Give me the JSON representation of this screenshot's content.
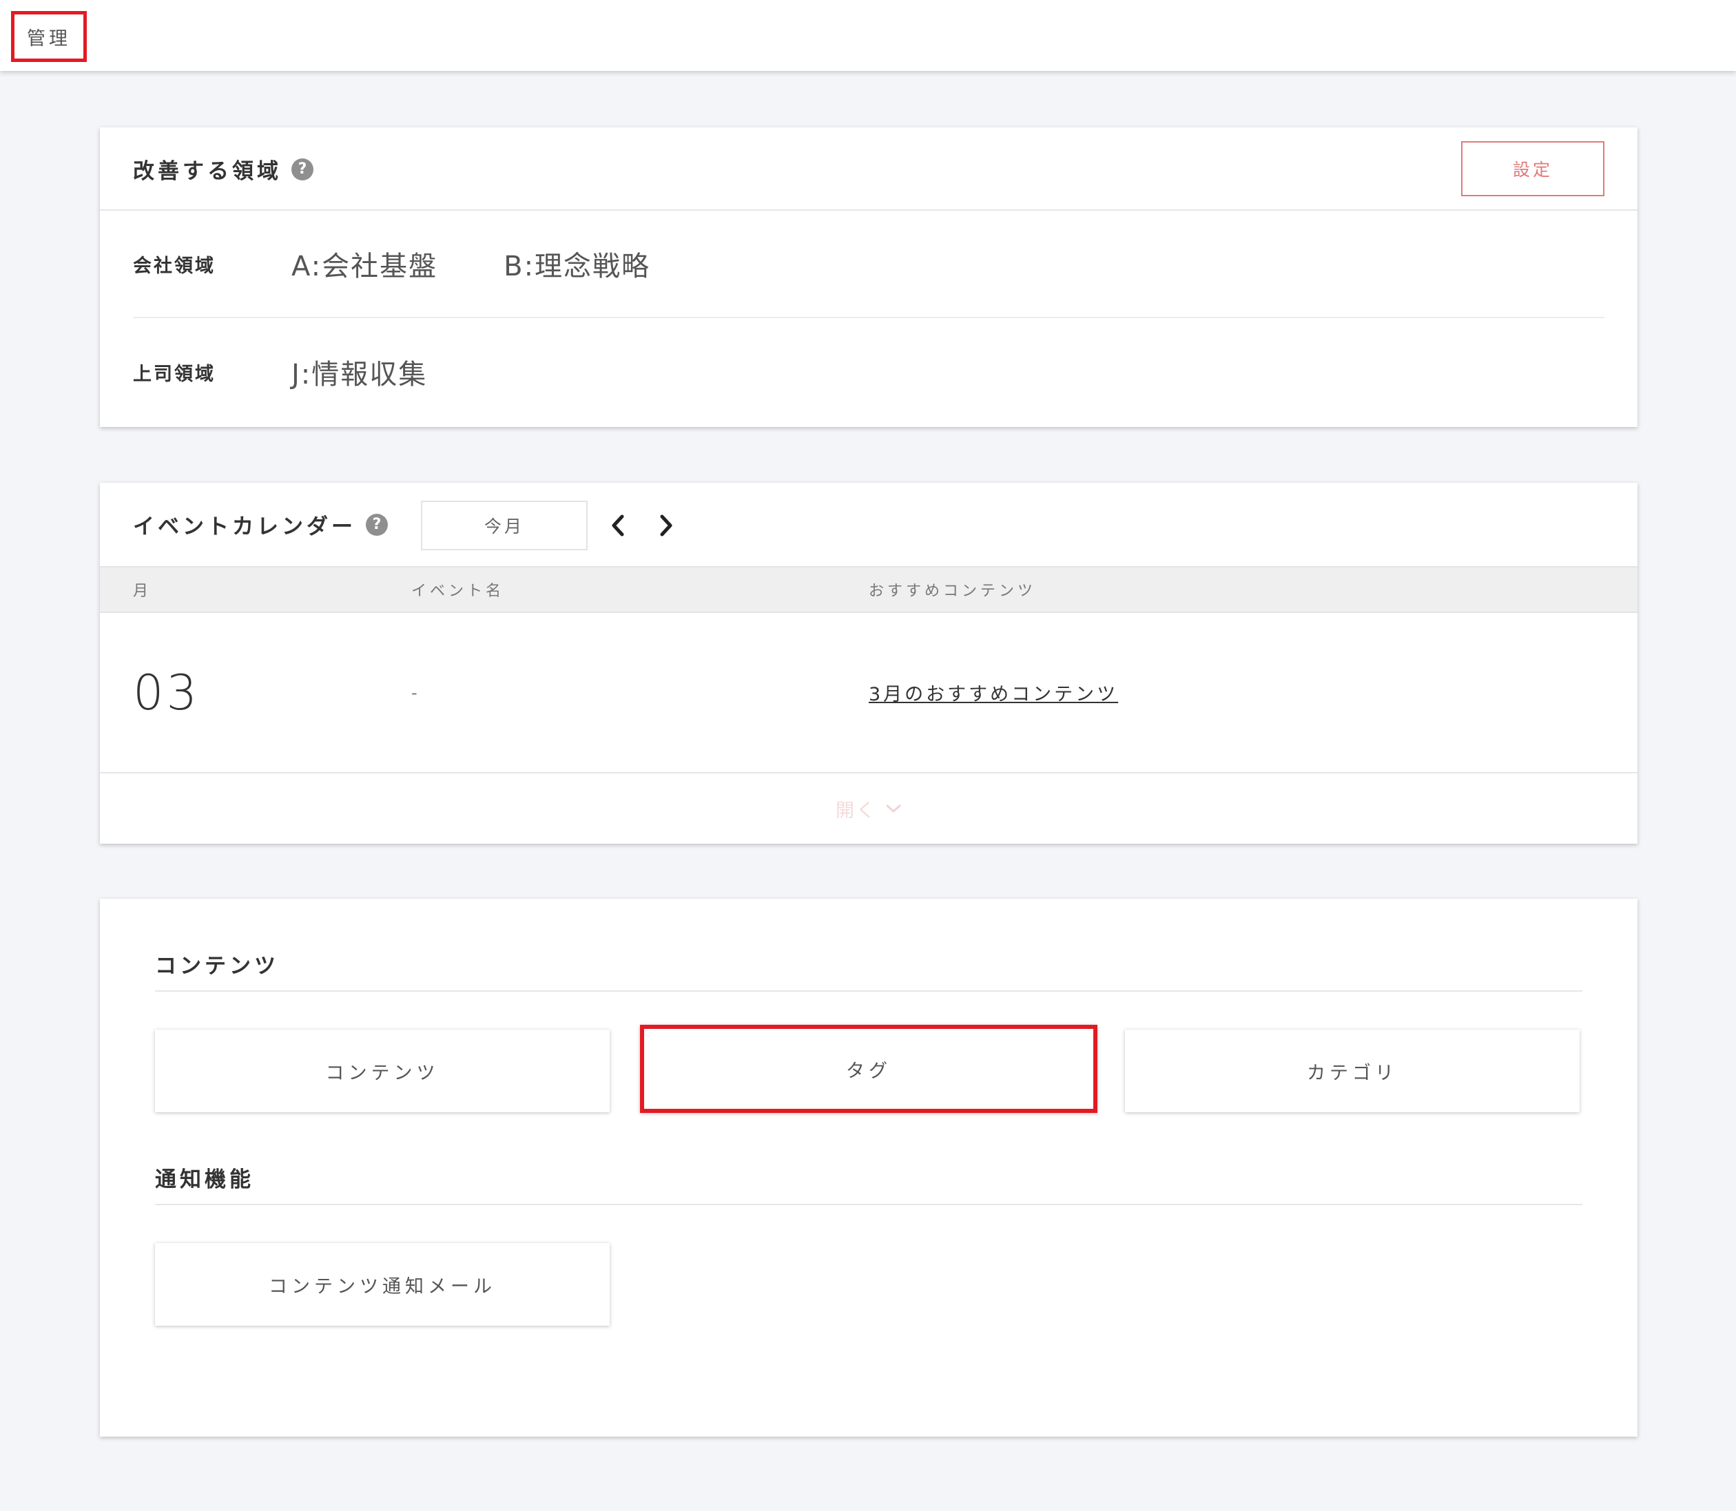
{
  "topbar": {
    "title": "管理"
  },
  "improvement": {
    "title": "改善する領域",
    "help": "?",
    "settings_label": "設定",
    "rows": [
      {
        "label": "会社領域",
        "values": [
          "A:会社基盤",
          "B:理念戦略"
        ]
      },
      {
        "label": "上司領域",
        "values": [
          "J:情報収集"
        ]
      }
    ]
  },
  "calendar": {
    "title": "イベントカレンダー",
    "help": "?",
    "this_month_label": "今月",
    "columns": [
      "月",
      "イベント名",
      "おすすめコンテンツ"
    ],
    "rows": [
      {
        "month": "03",
        "event": "-",
        "content": "3月のおすすめコンテンツ"
      }
    ],
    "expand_label": "開く"
  },
  "management": {
    "contents_section": {
      "title": "コンテンツ",
      "buttons": [
        "コンテンツ",
        "タグ",
        "カテゴリ"
      ]
    },
    "notify_section": {
      "title": "通知機能",
      "buttons": [
        "コンテンツ通知メール"
      ]
    }
  },
  "colors": {
    "highlight": "#e21b23",
    "accent": "#e07b7b",
    "background": "#f4f5f8"
  }
}
